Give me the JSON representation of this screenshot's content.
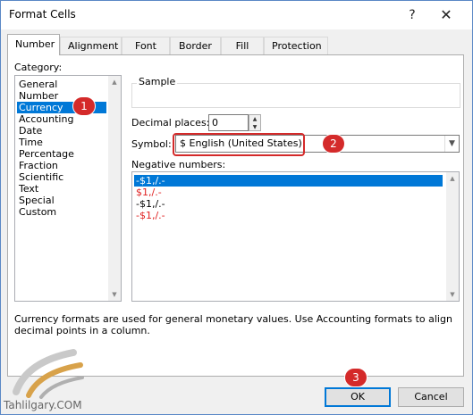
{
  "window": {
    "title": "Format Cells",
    "help": "?",
    "close": "✕"
  },
  "tabs": [
    {
      "label": "Number"
    },
    {
      "label": "Alignment"
    },
    {
      "label": "Font"
    },
    {
      "label": "Border"
    },
    {
      "label": "Fill"
    },
    {
      "label": "Protection"
    }
  ],
  "category": {
    "label": "Category:",
    "items": [
      "General",
      "Number",
      "Currency",
      "Accounting",
      "Date",
      "Time",
      "Percentage",
      "Fraction",
      "Scientific",
      "Text",
      "Special",
      "Custom"
    ],
    "selected": "Currency"
  },
  "sample": {
    "label": "Sample"
  },
  "decimal": {
    "label": "Decimal places:",
    "value": "0"
  },
  "symbol": {
    "label": "Symbol:",
    "value": "$ English (United States)"
  },
  "negative": {
    "label": "Negative numbers:",
    "items": [
      "-$1,/.-",
      "$1,/.-",
      "-$1,/.-",
      "-$1,/.-"
    ]
  },
  "description": "Currency formats are used for general monetary values.  Use Accounting formats to align decimal points in a column.",
  "buttons": {
    "ok": "OK",
    "cancel": "Cancel"
  },
  "markers": [
    "1",
    "2",
    "3"
  ],
  "watermark": "Tahlilgary.COM",
  "colors": {
    "selection": "#0078d7",
    "negative_red": "#e02020",
    "marker_red": "#d42a2a"
  }
}
